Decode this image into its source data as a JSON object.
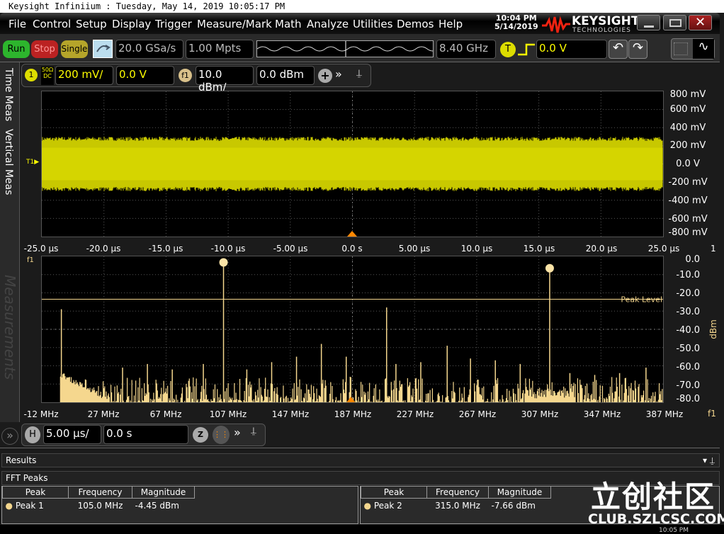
{
  "window": {
    "title": "Keysight Infiniium : Tuesday, May 14, 2019 10:05:17 PM",
    "clock_time": "10:04 PM",
    "clock_date": "5/14/2019",
    "brand": "KEYSIGHT",
    "brand_sub": "TECHNOLOGIES",
    "taskbar_time": "10:05 PM"
  },
  "menu": [
    "File",
    "Control",
    "Setup",
    "Display",
    "Trigger",
    "Measure/Mark",
    "Math",
    "Analyze",
    "Utilities",
    "Demos",
    "Help"
  ],
  "toolbar": {
    "run": "Run",
    "stop": "Stop",
    "single": "Single",
    "sample_rate": "20.0 GSa/s",
    "memory_depth": "1.00 Mpts",
    "bandwidth": "8.40 GHz",
    "trigger_label": "T",
    "trigger_level": "0.0 V",
    "colors": {
      "run": "#2db52d",
      "stop": "#b22",
      "single": "#b5a52a"
    }
  },
  "channel": {
    "ch1_label": "1",
    "ch1_coupling_top": "50Ω",
    "ch1_coupling_bottom": "DC",
    "ch1_scale": "200 mV/",
    "ch1_offset": "0.0 V",
    "f1_label": "f1",
    "f1_scale": "10.0 dBm/",
    "f1_offset": "0.0 dBm",
    "ch1_color": "#ffff00",
    "f1_color": "#f5d78e"
  },
  "side_tabs": {
    "time_meas": "Time Meas",
    "vertical_meas": "Vertical Meas",
    "measurements": "Measurements"
  },
  "time_plot": {
    "y_ticks": [
      "800 mV",
      "600 mV",
      "400 mV",
      "200 mV",
      "0.0 V",
      "-200 mV",
      "-400 mV",
      "-600 mV",
      "-800 mV"
    ],
    "x_ticks": [
      "-25.0 µs",
      "-20.0 µs",
      "-15.0 µs",
      "-10.0 µs",
      "-5.00 µs",
      "0.0 s",
      "5.00 µs",
      "10.0 µs",
      "15.0 µs",
      "20.0 µs",
      "25.0 µs"
    ],
    "channel_marker": "1",
    "trigger_marker": "T",
    "signal_amplitude_mv": 300
  },
  "chart_data": {
    "type": "bar",
    "xlabel": "",
    "ylabel": "dBm",
    "xlim": [
      -12,
      388
    ],
    "ylim": [
      -80,
      0
    ],
    "grid": true,
    "x_ticks": [
      "-12 MHz",
      "27 MHz",
      "67 MHz",
      "107 MHz",
      "147 MHz",
      "187 MHz",
      "227 MHz",
      "267 MHz",
      "307 MHz",
      "347 MHz",
      "387 MHz"
    ],
    "y_ticks": [
      "0.0",
      "-10.0",
      "-20.0",
      "-30.0",
      "-40.0",
      "-50.0",
      "-60.0",
      "-70.0",
      "-80.0"
    ],
    "x_axis_marker": "f1",
    "peak_level_label": "Peak Level",
    "peak_level_dbm": -23.5,
    "spikes": [
      {
        "mhz": 0.6,
        "dbm": -29
      },
      {
        "mhz": 40,
        "dbm": -61
      },
      {
        "mhz": 56,
        "dbm": -59
      },
      {
        "mhz": 72,
        "dbm": -62
      },
      {
        "mhz": 92,
        "dbm": -59
      },
      {
        "mhz": 105,
        "dbm": -4.45
      },
      {
        "mhz": 120,
        "dbm": -62
      },
      {
        "mhz": 136,
        "dbm": -58
      },
      {
        "mhz": 152,
        "dbm": -55
      },
      {
        "mhz": 168,
        "dbm": -48
      },
      {
        "mhz": 184,
        "dbm": -55
      },
      {
        "mhz": 210,
        "dbm": -28
      },
      {
        "mhz": 216,
        "dbm": -59
      },
      {
        "mhz": 232,
        "dbm": -58
      },
      {
        "mhz": 249,
        "dbm": -49
      },
      {
        "mhz": 264,
        "dbm": -56
      },
      {
        "mhz": 280,
        "dbm": -57
      },
      {
        "mhz": 296,
        "dbm": -59
      },
      {
        "mhz": 315,
        "dbm": -7.66
      },
      {
        "mhz": 328,
        "dbm": -64
      },
      {
        "mhz": 344,
        "dbm": -65
      },
      {
        "mhz": 360,
        "dbm": -64
      },
      {
        "mhz": 377,
        "dbm": -61
      }
    ],
    "markers": [
      {
        "mhz": 105,
        "dbm": -4.45
      },
      {
        "mhz": 315,
        "dbm": -7.66
      }
    ]
  },
  "horizontal": {
    "label": "H",
    "scale": "5.00 µs/",
    "position": "0.0 s",
    "zoom_label": "Z"
  },
  "results": {
    "title": "Results",
    "fft_title": "FFT Peaks",
    "headers": [
      "Peak",
      "Frequency",
      "Magnitude"
    ],
    "rows": [
      {
        "peak": "Peak 1",
        "frequency": "105.0 MHz",
        "magnitude": "-4.45 dBm"
      },
      {
        "peak": "Peak 2",
        "frequency": "315.0 MHz",
        "magnitude": "-7.66 dBm"
      }
    ]
  },
  "watermark": {
    "cn": "立创社区",
    "url": "CLUB.SZLCSC.COM"
  }
}
